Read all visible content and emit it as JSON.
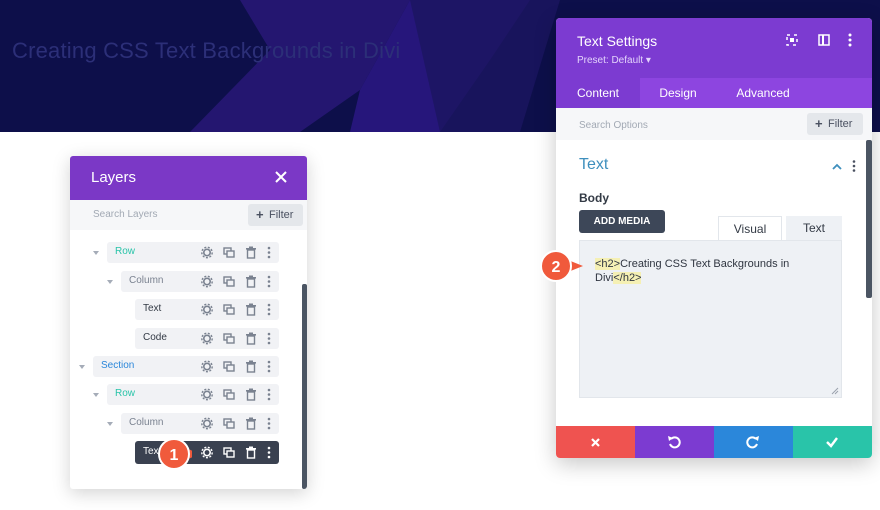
{
  "hero": {
    "title": "Creating CSS Text Backgrounds in Divi"
  },
  "layers_panel": {
    "title": "Layers",
    "search_placeholder": "Search Layers",
    "filter_label": "Filter",
    "tree": [
      {
        "label": "Row",
        "color": "#29c4a9"
      },
      {
        "label": "Column",
        "color": "#7a8290"
      },
      {
        "label": "Text",
        "color": "#333a45"
      },
      {
        "label": "Code",
        "color": "#333a45"
      },
      {
        "label": "Section",
        "color": "#2b87da"
      },
      {
        "label": "Row",
        "color": "#29c4a9"
      },
      {
        "label": "Column",
        "color": "#7a8290"
      },
      {
        "label": "Tex",
        "color": "#ffffff"
      }
    ]
  },
  "settings_modal": {
    "title": "Text Settings",
    "preset": "Preset: Default",
    "tabs": [
      "Content",
      "Design",
      "Advanced"
    ],
    "active_tab": "Content",
    "search_placeholder": "Search Options",
    "filter_label": "Filter",
    "section_title": "Text",
    "body_label": "Body",
    "add_media_label": "ADD MEDIA",
    "editor_tabs": [
      "Visual",
      "Text"
    ],
    "editor_content": {
      "open_tag": "<h2>",
      "text_line1": "Creating CSS Text Backgrounds in",
      "text_line2": "Divi",
      "close_tag": "</h2>"
    },
    "footer_buttons": [
      {
        "name": "cancel",
        "color": "#ef5350"
      },
      {
        "name": "undo",
        "color": "#7c3bd1"
      },
      {
        "name": "redo",
        "color": "#2b87da"
      },
      {
        "name": "save",
        "color": "#29c4a9"
      }
    ]
  },
  "callouts": [
    "1",
    "2"
  ],
  "colors": {
    "purple_header": "#7b38c6",
    "purple_tab": "#8d45e0",
    "hero_bg": "#0d0f4a",
    "callout": "#f05a3c"
  }
}
